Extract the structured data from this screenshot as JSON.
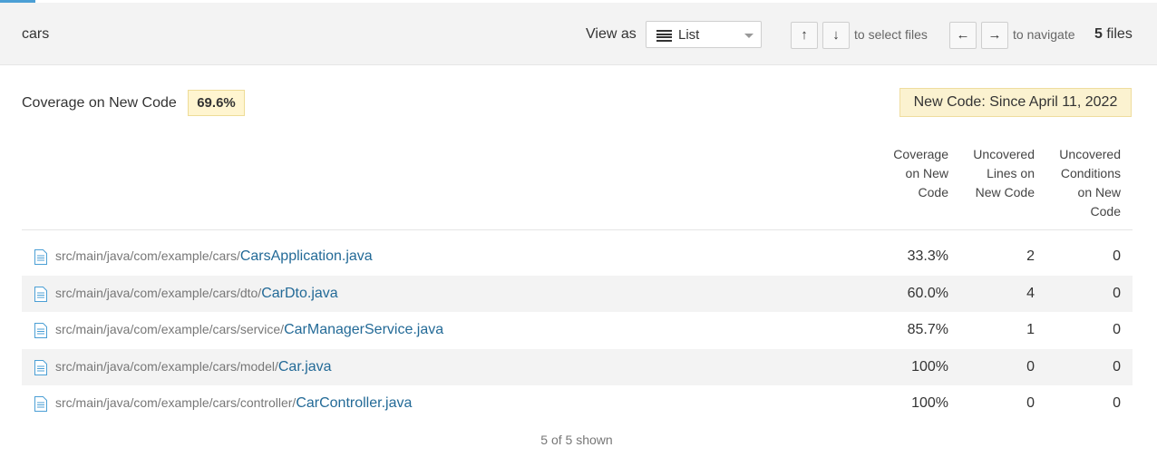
{
  "header": {
    "breadcrumb": "cars",
    "view_as_label": "View as",
    "view_select_value": "List",
    "up_key": "↑",
    "down_key": "↓",
    "select_hint": "to select files",
    "left_key": "←",
    "right_key": "→",
    "navigate_hint": "to navigate",
    "files_count": "5",
    "files_label": "files"
  },
  "summary": {
    "coverage_label": "Coverage on New Code",
    "coverage_value": "69.6%",
    "new_code_period": "New Code: Since April 11, 2022"
  },
  "table": {
    "columns": [
      [
        "Coverage",
        "on New",
        "Code"
      ],
      [
        "Uncovered",
        "Lines on",
        "New Code"
      ],
      [
        "Uncovered",
        "Conditions",
        "on New",
        "Code"
      ]
    ],
    "rows": [
      {
        "dir": "src/main/java/com/example/cars/",
        "file": "CarsApplication.java",
        "coverage": "33.3%",
        "uncovered_lines": "2",
        "uncovered_conditions": "0"
      },
      {
        "dir": "src/main/java/com/example/cars/dto/",
        "file": "CarDto.java",
        "coverage": "60.0%",
        "uncovered_lines": "4",
        "uncovered_conditions": "0"
      },
      {
        "dir": "src/main/java/com/example/cars/service/",
        "file": "CarManagerService.java",
        "coverage": "85.7%",
        "uncovered_lines": "1",
        "uncovered_conditions": "0"
      },
      {
        "dir": "src/main/java/com/example/cars/model/",
        "file": "Car.java",
        "coverage": "100%",
        "uncovered_lines": "0",
        "uncovered_conditions": "0"
      },
      {
        "dir": "src/main/java/com/example/cars/controller/",
        "file": "CarController.java",
        "coverage": "100%",
        "uncovered_lines": "0",
        "uncovered_conditions": "0"
      }
    ]
  },
  "footer": {
    "shown": "5 of 5 shown"
  },
  "icons": {
    "file": "file-icon",
    "list": "list-icon",
    "caret": "chevron-down-icon"
  },
  "colors": {
    "link": "#236a97",
    "badge_bg": "#fff5d0",
    "accent": "#4b9fd5"
  }
}
